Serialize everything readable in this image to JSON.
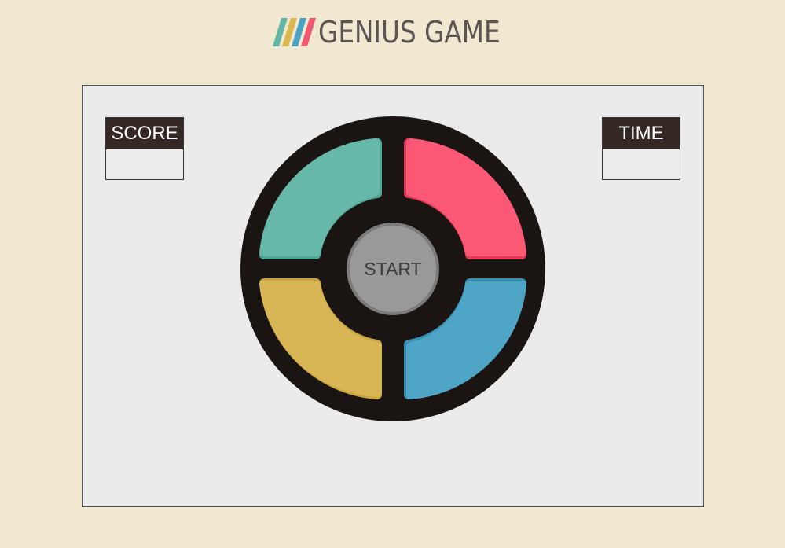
{
  "header": {
    "title": "GENIUS GAME",
    "logo_icon": "four-color-stripes-icon",
    "stripe_colors": [
      "#62b6a6",
      "#dcb750",
      "#4aa2c4",
      "#f3566f"
    ]
  },
  "scoreboard": {
    "score_label": "SCORE",
    "score_value": "",
    "time_label": "TIME",
    "time_value": ""
  },
  "game": {
    "start_label": "START",
    "pads": [
      {
        "name": "green",
        "color": "#66b8a8"
      },
      {
        "name": "red",
        "color": "#fa5875"
      },
      {
        "name": "yellow",
        "color": "#d8b656"
      },
      {
        "name": "blue",
        "color": "#4ea5c6"
      }
    ],
    "ring_color": "#1a1413",
    "start_color": "#999999"
  },
  "colors": {
    "background": "#f1e8d2",
    "board": "#ebebeb",
    "header_dark": "#342824",
    "title_text": "#5b5553"
  }
}
